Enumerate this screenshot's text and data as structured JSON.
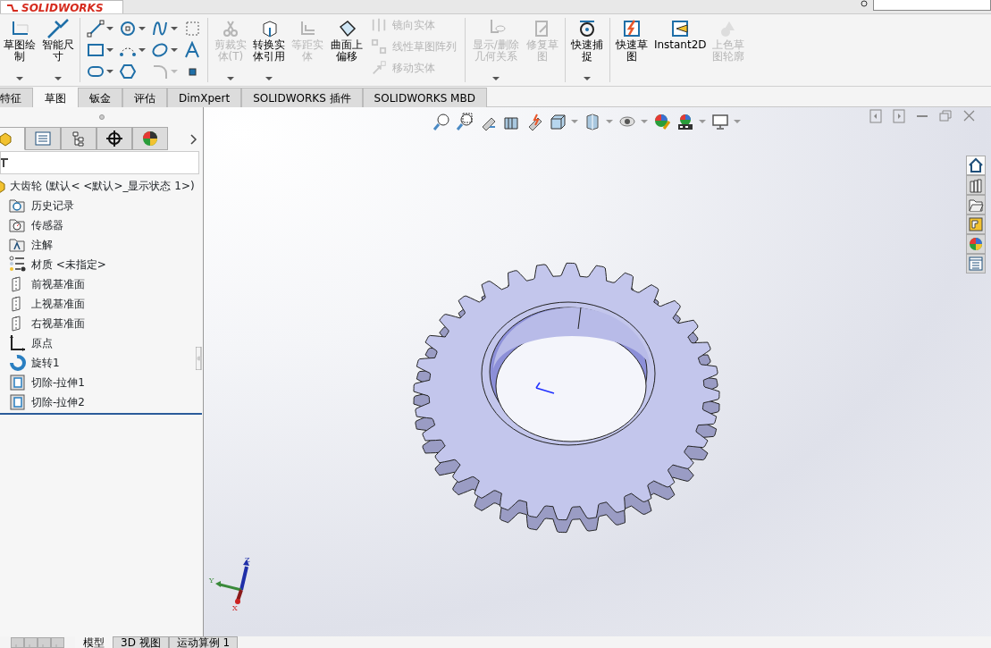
{
  "app": {
    "logo": "SOLIDWORKS"
  },
  "ribbon": {
    "tools": [
      {
        "kind": "large",
        "label": "草图绘制",
        "disabled": false,
        "dropdown": true
      },
      {
        "kind": "large",
        "label": "智能尺寸",
        "disabled": false,
        "dropdown": true
      },
      {
        "kind": "grid",
        "disabled_cells": [
          false,
          false,
          false,
          false,
          false,
          false,
          false,
          false,
          false,
          false,
          true,
          false
        ]
      },
      {
        "kind": "large",
        "label": "剪裁实体(T)",
        "disabled": true,
        "dropdown": true
      },
      {
        "kind": "large",
        "label": "转换实体引用",
        "disabled": false,
        "dropdown": true
      },
      {
        "kind": "large",
        "label": "等距实体",
        "disabled": true,
        "dropdown": false
      },
      {
        "kind": "large",
        "label": "曲面上偏移",
        "disabled": false,
        "dropdown": false
      },
      {
        "kind": "stack",
        "items": [
          {
            "label": "镜向实体",
            "disabled": true
          },
          {
            "label": "线性草图阵列",
            "disabled": true
          },
          {
            "label": "移动实体",
            "disabled": true
          }
        ]
      },
      {
        "kind": "large",
        "label": "显示/删除几何关系",
        "disabled": true,
        "dropdown": true
      },
      {
        "kind": "large",
        "label": "修复草图",
        "disabled": true,
        "dropdown": false
      },
      {
        "kind": "large",
        "label": "快速捕捉",
        "disabled": false,
        "dropdown": true
      },
      {
        "kind": "large",
        "label": "快速草图",
        "disabled": false,
        "dropdown": false
      },
      {
        "kind": "large",
        "label": "Instant2D",
        "disabled": false,
        "dropdown": false
      },
      {
        "kind": "large",
        "label": "上色草图轮廓",
        "disabled": true,
        "dropdown": false
      }
    ]
  },
  "tabs": [
    {
      "label": "特征",
      "selected": false
    },
    {
      "label": "草图",
      "selected": true
    },
    {
      "label": "钣金",
      "selected": false
    },
    {
      "label": "评估",
      "selected": false
    },
    {
      "label": "DimXpert",
      "selected": false
    },
    {
      "label": "SOLIDWORKS 插件",
      "selected": false
    },
    {
      "label": "SOLIDWORKS MBD",
      "selected": false
    }
  ],
  "panel": {
    "tabs": [
      {
        "selected": true
      },
      {
        "selected": false
      },
      {
        "selected": false
      },
      {
        "selected": false
      },
      {
        "selected": false
      }
    ],
    "tree": {
      "label": "大齿轮  (默认< <默认>_显示状态 1>)",
      "children": [
        {
          "label": "历史记录"
        },
        {
          "label": "传感器"
        },
        {
          "label": "注解"
        },
        {
          "label": "材质 <未指定>"
        },
        {
          "label": "前视基准面"
        },
        {
          "label": "上视基准面"
        },
        {
          "label": "右视基准面"
        },
        {
          "label": "原点"
        },
        {
          "label": "旋转1"
        },
        {
          "label": "切除-拉伸1"
        },
        {
          "label": "切除-拉伸2"
        }
      ]
    }
  },
  "viewport": {
    "task_pane": [
      {
        "selected": true
      },
      {
        "selected": false
      },
      {
        "selected": false
      },
      {
        "selected": false
      },
      {
        "selected": false
      },
      {
        "selected": false
      }
    ],
    "triad": {
      "x": "X",
      "y": "Y",
      "z": "Z"
    }
  },
  "bottom_tabs": [
    {
      "label": "模型",
      "selected": true
    },
    {
      "label": "3D 视图",
      "selected": false
    },
    {
      "label": "运动算例 1",
      "selected": false
    }
  ]
}
